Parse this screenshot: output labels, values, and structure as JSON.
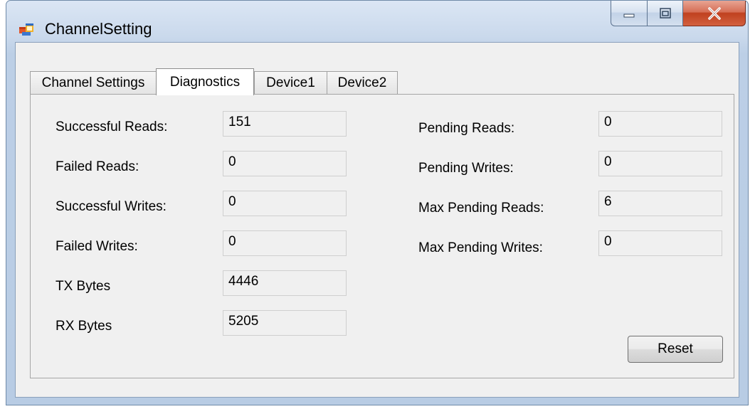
{
  "window": {
    "title": "ChannelSetting"
  },
  "tabs": [
    {
      "label": "Channel Settings",
      "active": false
    },
    {
      "label": "Diagnostics",
      "active": true
    },
    {
      "label": "Device1",
      "active": false
    },
    {
      "label": "Device2",
      "active": false
    }
  ],
  "diagnostics": {
    "left": [
      {
        "label": "Successful Reads:",
        "value": "151"
      },
      {
        "label": "Failed Reads:",
        "value": "0"
      },
      {
        "label": "Successful Writes:",
        "value": "0"
      },
      {
        "label": "Failed Writes:",
        "value": "0"
      },
      {
        "label": "TX Bytes",
        "value": "4446"
      },
      {
        "label": "RX Bytes",
        "value": "5205"
      }
    ],
    "right": [
      {
        "label": "Pending Reads:",
        "value": "0"
      },
      {
        "label": "Pending Writes:",
        "value": "0"
      },
      {
        "label": "Max Pending Reads:",
        "value": "6"
      },
      {
        "label": "Max Pending Writes:",
        "value": "0"
      }
    ],
    "reset_label": "Reset"
  },
  "icons": {
    "app": "app-window-icon",
    "minimize": "minimize-icon",
    "maximize": "maximize-icon",
    "close": "close-icon"
  },
  "colors": {
    "close_button": "#c7482a",
    "frame": "#b8cce4",
    "client_bg": "#f0f0f0"
  }
}
